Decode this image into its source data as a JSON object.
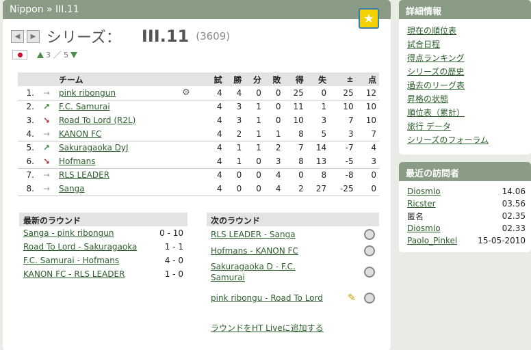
{
  "header": {
    "breadcrumb": "Nippon » III.11"
  },
  "title": {
    "label": "シリーズ：",
    "name": "III.11",
    "id": "(3609)"
  },
  "sub": {
    "level_up": "3",
    "level_sep": "／",
    "level_total": "5"
  },
  "table": {
    "headers": [
      "",
      "",
      "チーム",
      "",
      "試",
      "勝",
      "分",
      "敗",
      "得",
      "失",
      "±",
      "点"
    ],
    "rows": [
      {
        "pos": "1.",
        "trend": "same",
        "team": "pink ribongun",
        "icon": true,
        "p": "4",
        "w": "4",
        "d": "0",
        "l": "0",
        "gf": "25",
        "ga": "0",
        "diff": "25",
        "pts": "12"
      },
      {
        "pos": "2.",
        "trend": "up",
        "team": "F.C. Samurai",
        "icon": false,
        "p": "4",
        "w": "3",
        "d": "1",
        "l": "0",
        "gf": "11",
        "ga": "1",
        "diff": "10",
        "pts": "10"
      },
      {
        "pos": "3.",
        "trend": "down",
        "team": "Road To Lord (R2L)",
        "icon": false,
        "p": "4",
        "w": "3",
        "d": "1",
        "l": "0",
        "gf": "10",
        "ga": "3",
        "diff": "7",
        "pts": "10"
      },
      {
        "pos": "4.",
        "trend": "same",
        "team": "KANON FC",
        "icon": false,
        "p": "4",
        "w": "2",
        "d": "1",
        "l": "1",
        "gf": "8",
        "ga": "5",
        "diff": "3",
        "pts": "7"
      },
      {
        "pos": "5.",
        "trend": "up",
        "team": "Sakuragaoka DyJ",
        "icon": false,
        "p": "4",
        "w": "1",
        "d": "1",
        "l": "2",
        "gf": "7",
        "ga": "14",
        "diff": "-7",
        "pts": "4"
      },
      {
        "pos": "6.",
        "trend": "down",
        "team": "Hofmans",
        "icon": false,
        "p": "4",
        "w": "1",
        "d": "0",
        "l": "3",
        "gf": "8",
        "ga": "13",
        "diff": "-5",
        "pts": "3"
      },
      {
        "pos": "7.",
        "trend": "same",
        "team": "RLS LEADER",
        "icon": false,
        "p": "4",
        "w": "0",
        "d": "0",
        "l": "4",
        "gf": "0",
        "ga": "8",
        "diff": "-8",
        "pts": "0"
      },
      {
        "pos": "8.",
        "trend": "same",
        "team": "Sanga",
        "icon": false,
        "p": "4",
        "w": "0",
        "d": "0",
        "l": "4",
        "gf": "2",
        "ga": "27",
        "diff": "-25",
        "pts": "0"
      }
    ]
  },
  "latest": {
    "title": "最新のラウンド",
    "matches": [
      {
        "match": "Sanga - pink ribongun",
        "score": "0 - 10"
      },
      {
        "match": "Road To Lord - Sakuragaoka",
        "score": "1 - 1"
      },
      {
        "match": "F.C. Samurai - Hofmans",
        "score": "4 - 0"
      },
      {
        "match": "KANON FC - RLS LEADER",
        "score": "1 - 0"
      }
    ]
  },
  "next": {
    "title": "次のラウンド",
    "matches": [
      {
        "match": "RLS LEADER - Sanga"
      },
      {
        "match": "Hofmans - KANON FC"
      },
      {
        "match": "Sakuragaoka D - F.C. Samurai"
      },
      {
        "match": "pink ribongu - Road To Lord"
      }
    ],
    "add_live": "ラウンドをHT Liveに追加する"
  },
  "sidebar": {
    "title": "詳細情報",
    "links": [
      "現在の順位表",
      "試合日程",
      "得点ランキング",
      "シリーズの歴史",
      "過去のリーグ表",
      "昇格の状態",
      "順位表（累計）",
      "旅行 データ",
      "シリーズのフォーラム"
    ]
  },
  "visitors": {
    "title": "最近の訪問者",
    "rows": [
      {
        "name": "Diosmio",
        "time": "14.06",
        "link": true
      },
      {
        "name": "Ricster",
        "time": "03.56",
        "link": true
      },
      {
        "name": "匿名",
        "time": "02.35",
        "link": false
      },
      {
        "name": "Diosmio",
        "time": "02.33",
        "link": true
      },
      {
        "name": "Paolo_Pinkel",
        "time": "15-05-2010",
        "link": true
      }
    ]
  }
}
